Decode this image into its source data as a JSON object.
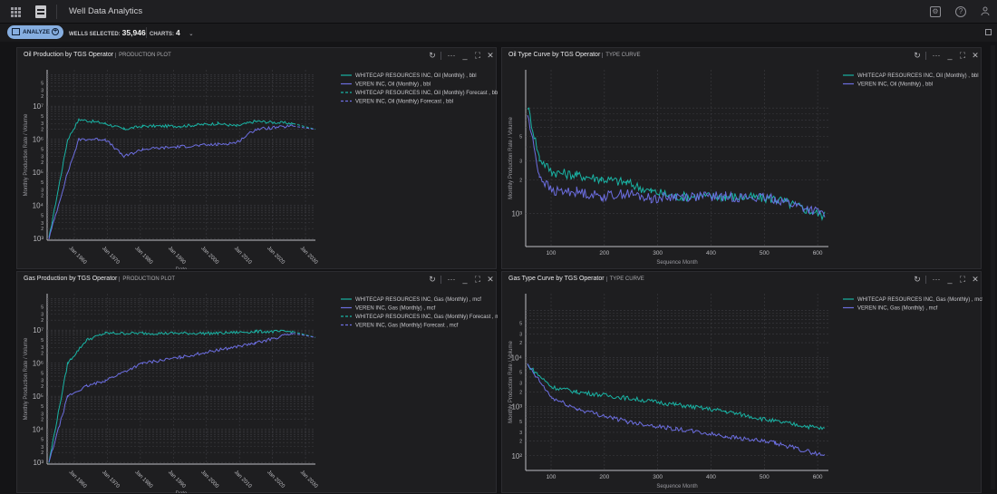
{
  "header": {
    "title": "Well Data Analytics"
  },
  "toolbar": {
    "analyze_label": "ANALYZE",
    "wells_label": "WELLS SELECTED:",
    "wells_value": "35,946",
    "charts_label": "CHARTS:",
    "charts_value": "4"
  },
  "panel_controls": {
    "refresh": "↻",
    "more": "···",
    "minimize": "_",
    "maximize": "⛶",
    "close": "✕"
  },
  "colors": {
    "teal": "#19b3a4",
    "purple": "#6c6ee0",
    "grid": "#3c3c40",
    "axis": "#bfbfc4"
  },
  "charts": [
    {
      "title": "Oil Production by TGS Operator",
      "subtitle": "PRODUCTION PLOT",
      "kind": "production",
      "xlabel": "Date",
      "ylabel": "Monthly Production Rate / Volume",
      "x_ticks": [
        "Jan 1960",
        "Jan 1970",
        "Jan 1980",
        "Jan 1990",
        "Jan 2000",
        "Jan 2010",
        "Jan 2020",
        "Jan 2030"
      ],
      "y_decades": [
        "10³",
        "10⁴",
        "10⁵",
        "10⁶",
        "10⁷"
      ],
      "legend": [
        "WHITECAP RESOURCES INC, Oil (Monthly) , bbl",
        "VEREN INC, Oil (Monthly) , bbl",
        "WHITECAP RESOURCES INC, Oil (Monthly) Forecast , bbl",
        "VEREN INC, Oil (Monthly) Forecast , bbl"
      ]
    },
    {
      "title": "Oil Type Curve by TGS Operator",
      "subtitle": "TYPE CURVE",
      "kind": "type",
      "xlabel": "Sequence Month",
      "ylabel": "Monthly Production Rate / Volume",
      "x_ticks": [
        "100",
        "200",
        "300",
        "400",
        "500",
        "600"
      ],
      "y_decades": [
        "10³"
      ],
      "legend": [
        "WHITECAP RESOURCES INC, Oil (Monthly) , bbl",
        "VEREN INC, Oil (Monthly) , bbl"
      ]
    },
    {
      "title": "Gas Production by TGS Operator",
      "subtitle": "PRODUCTION PLOT",
      "kind": "production",
      "xlabel": "Date",
      "ylabel": "Monthly Production Rate / Volume",
      "x_ticks": [
        "Jan 1960",
        "Jan 1970",
        "Jan 1980",
        "Jan 1990",
        "Jan 2000",
        "Jan 2010",
        "Jan 2020",
        "Jan 2030"
      ],
      "y_decades": [
        "10³",
        "10⁴",
        "10⁵",
        "10⁶",
        "10⁷"
      ],
      "legend": [
        "WHITECAP RESOURCES INC, Gas (Monthly) , mcf",
        "VEREN INC, Gas (Monthly) , mcf",
        "WHITECAP RESOURCES INC, Gas (Monthly) Forecast , mcf",
        "VEREN INC, Gas (Monthly) Forecast , mcf"
      ]
    },
    {
      "title": "Gas Type Curve by TGS Operator",
      "subtitle": "TYPE CURVE",
      "kind": "type",
      "xlabel": "Sequence Month",
      "ylabel": "Monthly Production Rate / Volume",
      "x_ticks": [
        "100",
        "200",
        "300",
        "400",
        "500",
        "600"
      ],
      "y_decades": [
        "10²",
        "10³",
        "10⁴"
      ],
      "legend": [
        "WHITECAP RESOURCES INC, Gas (Monthly) , mcf",
        "VEREN INC, Gas (Monthly) , mcf"
      ]
    }
  ],
  "chart_data": [
    {
      "type": "line",
      "title": "Oil Production by TGS Operator",
      "xlabel": "Date",
      "ylabel": "Monthly Production Rate / Volume",
      "y_scale": "log",
      "x": [
        1955,
        1960,
        1963,
        1970,
        1975,
        1980,
        1990,
        2000,
        2005,
        2010,
        2020,
        2026
      ],
      "series": [
        {
          "name": "WHITECAP RESOURCES INC, Oil (Monthly) , bbl",
          "values": [
            1000,
            1000000,
            4000000,
            3000000,
            2000000,
            2500000,
            2500000,
            3000000,
            2500000,
            3500000,
            3000000,
            2000000
          ]
        },
        {
          "name": "VEREN INC, Oil (Monthly) , bbl",
          "values": [
            1000,
            100000,
            1000000,
            1000000,
            300000,
            500000,
            600000,
            700000,
            800000,
            2000000,
            2500000,
            2000000
          ]
        }
      ]
    },
    {
      "type": "line",
      "title": "Oil Type Curve by TGS Operator",
      "xlabel": "Sequence Month",
      "ylabel": "Monthly Production Rate / Volume",
      "y_scale": "log",
      "x": [
        1,
        25,
        50,
        100,
        150,
        200,
        250,
        300,
        400,
        500,
        600
      ],
      "series": [
        {
          "name": "WHITECAP RESOURCES INC, Oil (Monthly) , bbl",
          "values": [
            3000,
            1000,
            750,
            700,
            650,
            600,
            500,
            450,
            450,
            430,
            300
          ]
        },
        {
          "name": "VEREN INC, Oil (Monthly) , bbl",
          "values": [
            2500,
            700,
            500,
            500,
            450,
            480,
            430,
            450,
            450,
            430,
            310
          ]
        }
      ]
    },
    {
      "type": "line",
      "title": "Gas Production by TGS Operator",
      "xlabel": "Date",
      "ylabel": "Monthly Production Rate / Volume",
      "y_scale": "log",
      "x": [
        1955,
        1960,
        1965,
        1970,
        1980,
        1990,
        2000,
        2010,
        2020,
        2026
      ],
      "series": [
        {
          "name": "WHITECAP RESOURCES INC, Gas (Monthly) , mcf",
          "values": [
            1000,
            1000000,
            5000000,
            8000000,
            8000000,
            8000000,
            8000000,
            9000000,
            9000000,
            6000000
          ]
        },
        {
          "name": "VEREN INC, Gas (Monthly) , mcf",
          "values": [
            1000,
            100000,
            200000,
            300000,
            1000000,
            1500000,
            2500000,
            4000000,
            8000000,
            6000000
          ]
        }
      ]
    },
    {
      "type": "line",
      "title": "Gas Type Curve by TGS Operator",
      "xlabel": "Sequence Month",
      "ylabel": "Monthly Production Rate / Volume",
      "y_scale": "log",
      "x": [
        1,
        50,
        100,
        200,
        300,
        400,
        500,
        600
      ],
      "series": [
        {
          "name": "WHITECAP RESOURCES INC, Gas (Monthly) , mcf",
          "values": [
            7000,
            2500,
            2000,
            1500,
            1100,
            800,
            500,
            350
          ]
        },
        {
          "name": "VEREN INC, Gas (Monthly) , mcf",
          "values": [
            7000,
            1500,
            900,
            500,
            350,
            250,
            180,
            100
          ]
        }
      ]
    }
  ]
}
